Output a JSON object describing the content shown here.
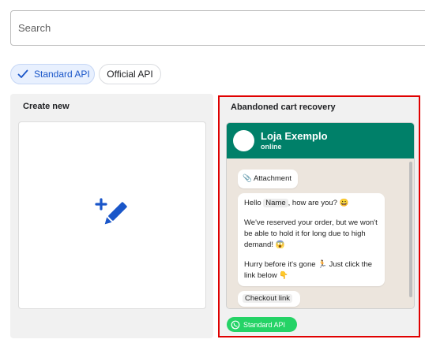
{
  "search": {
    "placeholder": "Search",
    "value": ""
  },
  "filters": {
    "standard_label": "Standard API",
    "official_label": "Official API",
    "selected": "Standard API"
  },
  "create_card": {
    "title": "Create new",
    "icon": "edit-pencil-plus-icon"
  },
  "template_card": {
    "title": "Abandoned cart recovery",
    "contact": {
      "name": "Loja Exemplo",
      "status": "online"
    },
    "attachment": "📎 Attachment",
    "message": {
      "greeting_pre": "Hello ",
      "variable": "Name",
      "greeting_post": ", how are you? 😀",
      "paragraph2": "We've reserved your order, but we won't be able to hold it for long due to high demand! 😱",
      "paragraph3": "Hurry before it's gone 🏃 Just click the link below 👇"
    },
    "button_label": "Checkout link",
    "badge_label": "Standard API"
  },
  "colors": {
    "selected_chip": "#e8f0fe",
    "accent_blue": "#1a56c9",
    "whatsapp_header": "#008069",
    "whatsapp_green": "#25d366",
    "highlight_border": "#e00000"
  }
}
